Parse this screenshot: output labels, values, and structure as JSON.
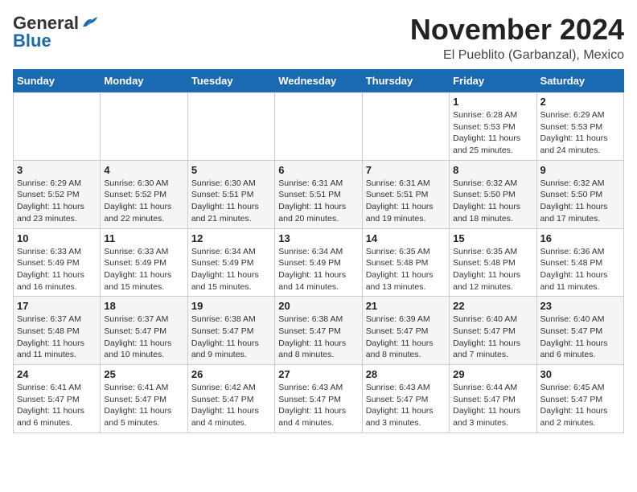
{
  "logo": {
    "general": "General",
    "blue": "Blue"
  },
  "title": "November 2024",
  "location": "El Pueblito (Garbanzal), Mexico",
  "days_of_week": [
    "Sunday",
    "Monday",
    "Tuesday",
    "Wednesday",
    "Thursday",
    "Friday",
    "Saturday"
  ],
  "weeks": [
    [
      {
        "day": "",
        "info": ""
      },
      {
        "day": "",
        "info": ""
      },
      {
        "day": "",
        "info": ""
      },
      {
        "day": "",
        "info": ""
      },
      {
        "day": "",
        "info": ""
      },
      {
        "day": "1",
        "info": "Sunrise: 6:28 AM\nSunset: 5:53 PM\nDaylight: 11 hours\nand 25 minutes."
      },
      {
        "day": "2",
        "info": "Sunrise: 6:29 AM\nSunset: 5:53 PM\nDaylight: 11 hours\nand 24 minutes."
      }
    ],
    [
      {
        "day": "3",
        "info": "Sunrise: 6:29 AM\nSunset: 5:52 PM\nDaylight: 11 hours\nand 23 minutes."
      },
      {
        "day": "4",
        "info": "Sunrise: 6:30 AM\nSunset: 5:52 PM\nDaylight: 11 hours\nand 22 minutes."
      },
      {
        "day": "5",
        "info": "Sunrise: 6:30 AM\nSunset: 5:51 PM\nDaylight: 11 hours\nand 21 minutes."
      },
      {
        "day": "6",
        "info": "Sunrise: 6:31 AM\nSunset: 5:51 PM\nDaylight: 11 hours\nand 20 minutes."
      },
      {
        "day": "7",
        "info": "Sunrise: 6:31 AM\nSunset: 5:51 PM\nDaylight: 11 hours\nand 19 minutes."
      },
      {
        "day": "8",
        "info": "Sunrise: 6:32 AM\nSunset: 5:50 PM\nDaylight: 11 hours\nand 18 minutes."
      },
      {
        "day": "9",
        "info": "Sunrise: 6:32 AM\nSunset: 5:50 PM\nDaylight: 11 hours\nand 17 minutes."
      }
    ],
    [
      {
        "day": "10",
        "info": "Sunrise: 6:33 AM\nSunset: 5:49 PM\nDaylight: 11 hours\nand 16 minutes."
      },
      {
        "day": "11",
        "info": "Sunrise: 6:33 AM\nSunset: 5:49 PM\nDaylight: 11 hours\nand 15 minutes."
      },
      {
        "day": "12",
        "info": "Sunrise: 6:34 AM\nSunset: 5:49 PM\nDaylight: 11 hours\nand 15 minutes."
      },
      {
        "day": "13",
        "info": "Sunrise: 6:34 AM\nSunset: 5:49 PM\nDaylight: 11 hours\nand 14 minutes."
      },
      {
        "day": "14",
        "info": "Sunrise: 6:35 AM\nSunset: 5:48 PM\nDaylight: 11 hours\nand 13 minutes."
      },
      {
        "day": "15",
        "info": "Sunrise: 6:35 AM\nSunset: 5:48 PM\nDaylight: 11 hours\nand 12 minutes."
      },
      {
        "day": "16",
        "info": "Sunrise: 6:36 AM\nSunset: 5:48 PM\nDaylight: 11 hours\nand 11 minutes."
      }
    ],
    [
      {
        "day": "17",
        "info": "Sunrise: 6:37 AM\nSunset: 5:48 PM\nDaylight: 11 hours\nand 11 minutes."
      },
      {
        "day": "18",
        "info": "Sunrise: 6:37 AM\nSunset: 5:47 PM\nDaylight: 11 hours\nand 10 minutes."
      },
      {
        "day": "19",
        "info": "Sunrise: 6:38 AM\nSunset: 5:47 PM\nDaylight: 11 hours\nand 9 minutes."
      },
      {
        "day": "20",
        "info": "Sunrise: 6:38 AM\nSunset: 5:47 PM\nDaylight: 11 hours\nand 8 minutes."
      },
      {
        "day": "21",
        "info": "Sunrise: 6:39 AM\nSunset: 5:47 PM\nDaylight: 11 hours\nand 8 minutes."
      },
      {
        "day": "22",
        "info": "Sunrise: 6:40 AM\nSunset: 5:47 PM\nDaylight: 11 hours\nand 7 minutes."
      },
      {
        "day": "23",
        "info": "Sunrise: 6:40 AM\nSunset: 5:47 PM\nDaylight: 11 hours\nand 6 minutes."
      }
    ],
    [
      {
        "day": "24",
        "info": "Sunrise: 6:41 AM\nSunset: 5:47 PM\nDaylight: 11 hours\nand 6 minutes."
      },
      {
        "day": "25",
        "info": "Sunrise: 6:41 AM\nSunset: 5:47 PM\nDaylight: 11 hours\nand 5 minutes."
      },
      {
        "day": "26",
        "info": "Sunrise: 6:42 AM\nSunset: 5:47 PM\nDaylight: 11 hours\nand 4 minutes."
      },
      {
        "day": "27",
        "info": "Sunrise: 6:43 AM\nSunset: 5:47 PM\nDaylight: 11 hours\nand 4 minutes."
      },
      {
        "day": "28",
        "info": "Sunrise: 6:43 AM\nSunset: 5:47 PM\nDaylight: 11 hours\nand 3 minutes."
      },
      {
        "day": "29",
        "info": "Sunrise: 6:44 AM\nSunset: 5:47 PM\nDaylight: 11 hours\nand 3 minutes."
      },
      {
        "day": "30",
        "info": "Sunrise: 6:45 AM\nSunset: 5:47 PM\nDaylight: 11 hours\nand 2 minutes."
      }
    ]
  ]
}
